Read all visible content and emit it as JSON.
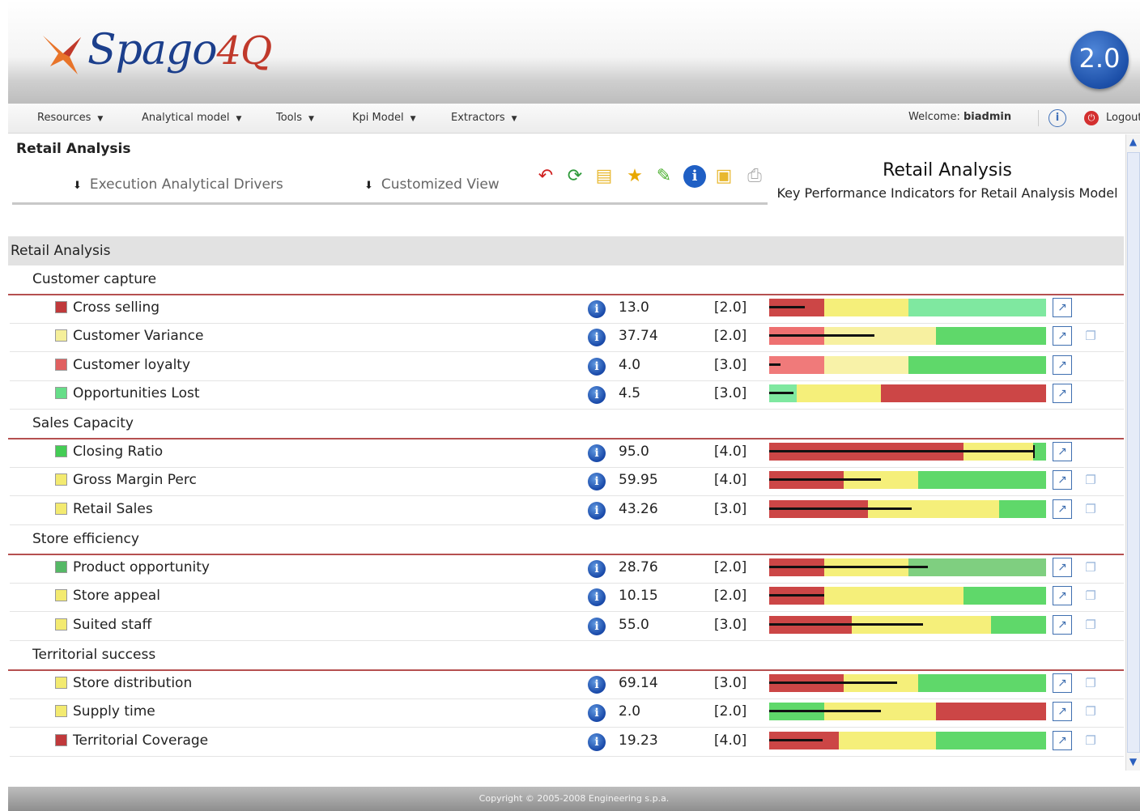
{
  "app": {
    "logo_text": "Spago",
    "logo_num": "4Q",
    "version": "2.0"
  },
  "menu": {
    "items": [
      "Resources",
      "Analytical model",
      "Tools",
      "Kpi Model",
      "Extractors"
    ],
    "welcome_label": "Welcome:",
    "username": "biadmin",
    "logout": "Logout"
  },
  "page": {
    "title": "Retail Analysis",
    "tabs": [
      "Execution Analytical Drivers",
      "Customized View"
    ],
    "doc_title": "Retail Analysis",
    "doc_subtitle": "Key Performance Indicators for Retail Analysis Model"
  },
  "toolbar_icons": [
    "back-icon",
    "refresh-icon",
    "add-document-icon",
    "star-icon",
    "edit-icon",
    "info-icon",
    "export-icon",
    "print-icon"
  ],
  "root": "Retail Analysis",
  "groups": [
    {
      "name": "Customer capture",
      "kpis": [
        {
          "name": "Cross selling",
          "status": "#c0393b",
          "value": "13.0",
          "weight": "[2.0]"
        },
        {
          "name": "Customer Variance",
          "status": "#f5ef9a",
          "value": "37.74",
          "weight": "[2.0]"
        },
        {
          "name": "Customer loyalty",
          "status": "#e06060",
          "value": "4.0",
          "weight": "[3.0]"
        },
        {
          "name": "Opportunities Lost",
          "status": "#66dd88",
          "value": "4.5",
          "weight": "[3.0]"
        }
      ]
    },
    {
      "name": "Sales Capacity",
      "kpis": [
        {
          "name": "Closing Ratio",
          "status": "#44cc55",
          "value": "95.0",
          "weight": "[4.0]"
        },
        {
          "name": "Gross Margin Perc",
          "status": "#f3ea70",
          "value": "59.95",
          "weight": "[4.0]"
        },
        {
          "name": "Retail Sales",
          "status": "#f3ea70",
          "value": "43.26",
          "weight": "[3.0]"
        }
      ]
    },
    {
      "name": "Store efficiency",
      "kpis": [
        {
          "name": "Product opportunity",
          "status": "#55b866",
          "value": "28.76",
          "weight": "[2.0]"
        },
        {
          "name": "Store appeal",
          "status": "#f3ea70",
          "value": "10.15",
          "weight": "[2.0]"
        },
        {
          "name": "Suited staff",
          "status": "#f3ea70",
          "value": "55.0",
          "weight": "[3.0]"
        }
      ]
    },
    {
      "name": "Territorial success",
      "kpis": [
        {
          "name": "Store distribution",
          "status": "#f3ea70",
          "value": "69.14",
          "weight": "[3.0]"
        },
        {
          "name": "Supply time",
          "status": "#f3ea70",
          "value": "2.0",
          "weight": "[2.0]"
        },
        {
          "name": "Territorial Coverage",
          "status": "#c0393b",
          "value": "19.23",
          "weight": "[4.0]"
        }
      ]
    }
  ],
  "footer": "Copyright © 2005-2008 Engineering s.p.a."
}
